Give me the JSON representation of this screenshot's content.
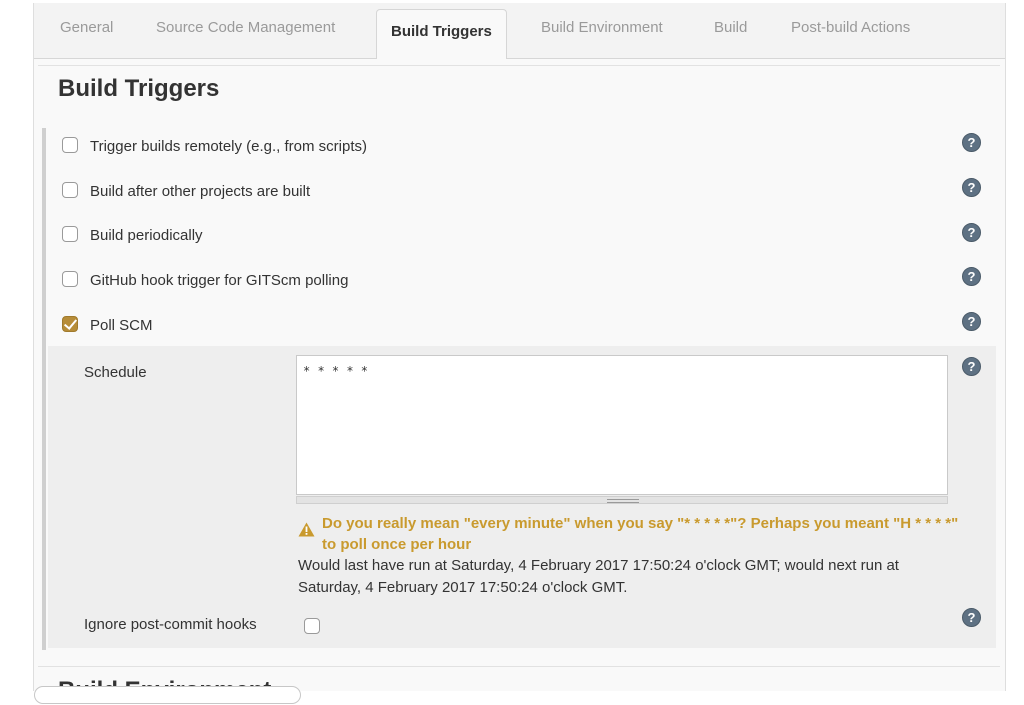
{
  "tabs": [
    {
      "label": "General"
    },
    {
      "label": "Source Code Management"
    },
    {
      "label": "Build Triggers",
      "active": true
    },
    {
      "label": "Build Environment"
    },
    {
      "label": "Build"
    },
    {
      "label": "Post-build Actions"
    }
  ],
  "section": {
    "title": "Build Triggers"
  },
  "triggers": [
    {
      "label": "Trigger builds remotely (e.g., from scripts)",
      "checked": false
    },
    {
      "label": "Build after other projects are built",
      "checked": false
    },
    {
      "label": "Build periodically",
      "checked": false
    },
    {
      "label": "GitHub hook trigger for GITScm polling",
      "checked": false
    },
    {
      "label": "Poll SCM",
      "checked": true
    }
  ],
  "poll_scm": {
    "schedule_label": "Schedule",
    "schedule_value": "* * * * *",
    "warning": "Do you really mean \"every minute\" when you say \"* * * * *\"? Perhaps you meant \"H * * * *\" to poll once per hour",
    "info": "Would last have run at Saturday, 4 February 2017 17:50:24 o'clock GMT; would next run at Saturday, 4 February 2017 17:50:24 o'clock GMT.",
    "ignore_label": "Ignore post-commit hooks",
    "ignore_checked": false
  },
  "help_icon": {
    "glyph": "?",
    "color": "#5e7183"
  },
  "next_section": {
    "title": "Build Environment"
  },
  "colors": {
    "accent": "#b78d39",
    "warning": "#c99a2e"
  }
}
